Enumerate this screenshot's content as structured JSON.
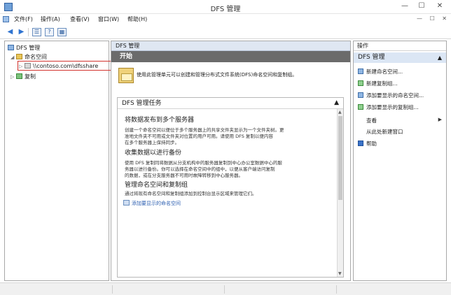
{
  "window": {
    "title": "DFS 管理",
    "min": "—",
    "max": "☐",
    "close": "✕"
  },
  "menu": [
    "文件(F)",
    "操作(A)",
    "查看(V)",
    "窗口(W)",
    "帮助(H)"
  ],
  "mdi_buttons": [
    "—",
    "☐",
    "✕"
  ],
  "tree": {
    "root": "DFS 管理",
    "namespaces": "命名空间",
    "share": "\\\\contoso.com\\dfsshare",
    "replication": "复制"
  },
  "center": {
    "header": "DFS 管理",
    "banner": "开始",
    "welcome": "使用此管理单元可以创建和管理分布式文件系统(DFS)命名空间和复制组。",
    "tasks_title": "DFS 管理任务",
    "sections": [
      {
        "title": "将数据发布到多个服务器",
        "lines": [
          "创建一个命名空间以便位于多个服务器上的共享文件夹显示为一个文件夹树。更",
          "准地文件夹不可用或文件夹对位置的用户可用。请使用 DFS 复制以便内容",
          "在多个服务器上保持同步。"
        ]
      },
      {
        "title": "收集数据以进行备份",
        "lines": [
          "使用 DFS 复制同将数据从分支机构中的服务器复制到中心办公室数据中心的服",
          "务器以进行备份。你可以选择在命名空间中的组中，以便从客户端访问复制",
          "的数据，或在分支服务器不可用时故障转移到中心服务器。"
        ]
      },
      {
        "title": "管理命名空间和复制组",
        "lines": [
          "通过将现有命名空间和复制组添加到控制台显示区域来管理它们。"
        ]
      }
    ],
    "link": "添加要显示的命名空间"
  },
  "actions": {
    "header": "操作",
    "group": "DFS 管理",
    "items": [
      {
        "label": "新建命名空间...",
        "icon": "namespace-icon"
      },
      {
        "label": "新建复制组...",
        "icon": "replication-icon"
      },
      {
        "label": "添加要显示的命名空间...",
        "icon": "namespace-icon"
      },
      {
        "label": "添加要显示的复制组...",
        "icon": "replication-icon"
      },
      {
        "label": "查看",
        "icon": ""
      },
      {
        "label": "从此处新建窗口",
        "icon": ""
      },
      {
        "label": "帮助",
        "icon": "help-icon"
      }
    ]
  },
  "colors": {
    "banner": "#6b6b6b",
    "group_bg": "#dbe6f4",
    "link": "#2a5db0",
    "highlight": "#d2322d"
  }
}
